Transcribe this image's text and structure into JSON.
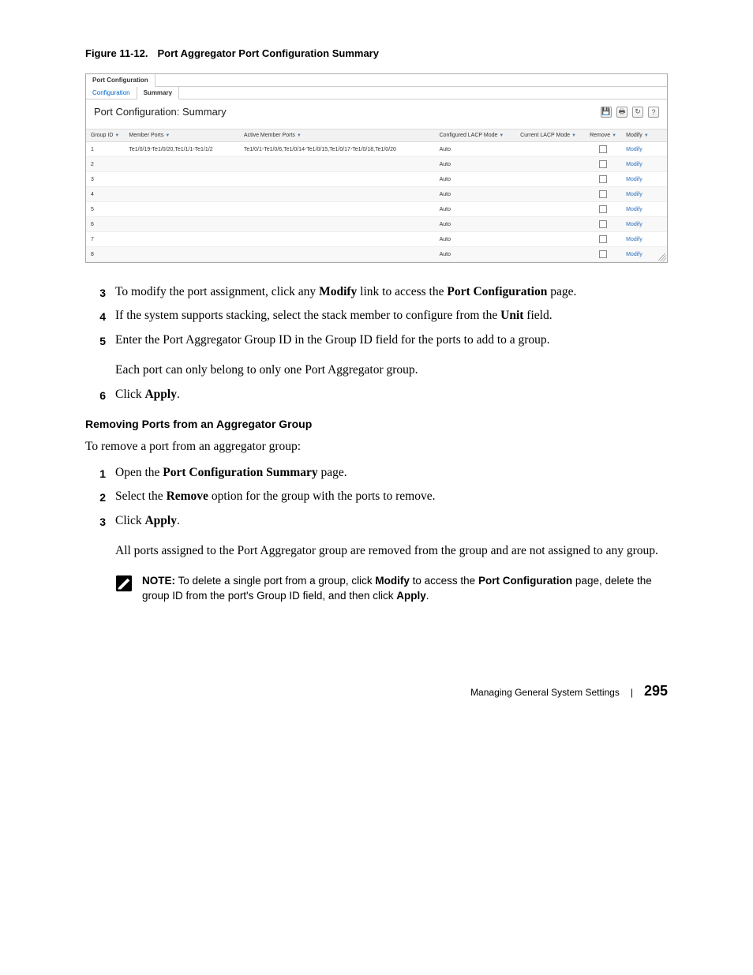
{
  "figure": {
    "label": "Figure 11-12.",
    "title": "Port Aggregator Port Configuration Summary"
  },
  "screenshot": {
    "top_tab": "Port Configuration",
    "sub_tabs": {
      "left": "Configuration",
      "right": "Summary"
    },
    "panel_title": "Port Configuration: Summary",
    "columns": {
      "group_id": "Group ID",
      "member_ports": "Member Ports",
      "active_member_ports": "Active Member Ports",
      "configured_lacp": "Configured LACP Mode",
      "current_lacp": "Current LACP Mode",
      "remove": "Remove",
      "modify": "Modify"
    },
    "rows": [
      {
        "id": "1",
        "mp": "Te1/0/19-Te1/0/20,Te1/1/1-Te1/1/2",
        "amp": "Te1/0/1-Te1/0/6,Te1/0/14-Te1/0/15,Te1/0/17-Te1/0/18,Te1/0/20",
        "clm": "Auto",
        "culm": ""
      },
      {
        "id": "2",
        "mp": "",
        "amp": "",
        "clm": "Auto",
        "culm": ""
      },
      {
        "id": "3",
        "mp": "",
        "amp": "",
        "clm": "Auto",
        "culm": ""
      },
      {
        "id": "4",
        "mp": "",
        "amp": "",
        "clm": "Auto",
        "culm": ""
      },
      {
        "id": "5",
        "mp": "",
        "amp": "",
        "clm": "Auto",
        "culm": ""
      },
      {
        "id": "6",
        "mp": "",
        "amp": "",
        "clm": "Auto",
        "culm": ""
      },
      {
        "id": "7",
        "mp": "",
        "amp": "",
        "clm": "Auto",
        "culm": ""
      },
      {
        "id": "8",
        "mp": "",
        "amp": "",
        "clm": "Auto",
        "culm": ""
      }
    ],
    "modify_label": "Modify"
  },
  "steps1": {
    "s3a": "To modify the port assignment, click any ",
    "s3b": "Modify",
    "s3c": " link to access the ",
    "s3d": "Port Configuration",
    "s3e": " page.",
    "s4a": "If the system supports stacking, select the stack member to configure from the ",
    "s4b": "Unit",
    "s4c": " field.",
    "s5": "Enter the Port Aggregator Group ID in the Group ID field for the ports to add to a group.",
    "s5p": "Each port can only belong to only one Port Aggregator group.",
    "s6a": "Click ",
    "s6b": "Apply",
    "s6c": "."
  },
  "section2": {
    "heading": "Removing Ports from an Aggregator Group",
    "intro": "To remove a port from an aggregator group:",
    "s1a": "Open the ",
    "s1b": "Port Configuration Summary",
    "s1c": " page.",
    "s2a": "Select the ",
    "s2b": "Remove",
    "s2c": " option for the group with the ports to remove.",
    "s3a": "Click ",
    "s3b": "Apply",
    "s3c": ".",
    "s3p": "All ports assigned to the Port Aggregator group are removed from the group and are not assigned to any group."
  },
  "note": {
    "label": "NOTE:",
    "t1": " To delete a single port from a group, click ",
    "b1": "Modify",
    "t2": " to access the ",
    "b2": "Port Configuration",
    "t3": " page, delete the group ID from the port's Group ID field, and then click ",
    "b3": "Apply",
    "t4": "."
  },
  "footer": {
    "text": "Managing General System Settings",
    "page": "295"
  },
  "numbers": {
    "n3": "3",
    "n4": "4",
    "n5": "5",
    "n6": "6",
    "n1b": "1",
    "n2b": "2",
    "n3b": "3"
  }
}
